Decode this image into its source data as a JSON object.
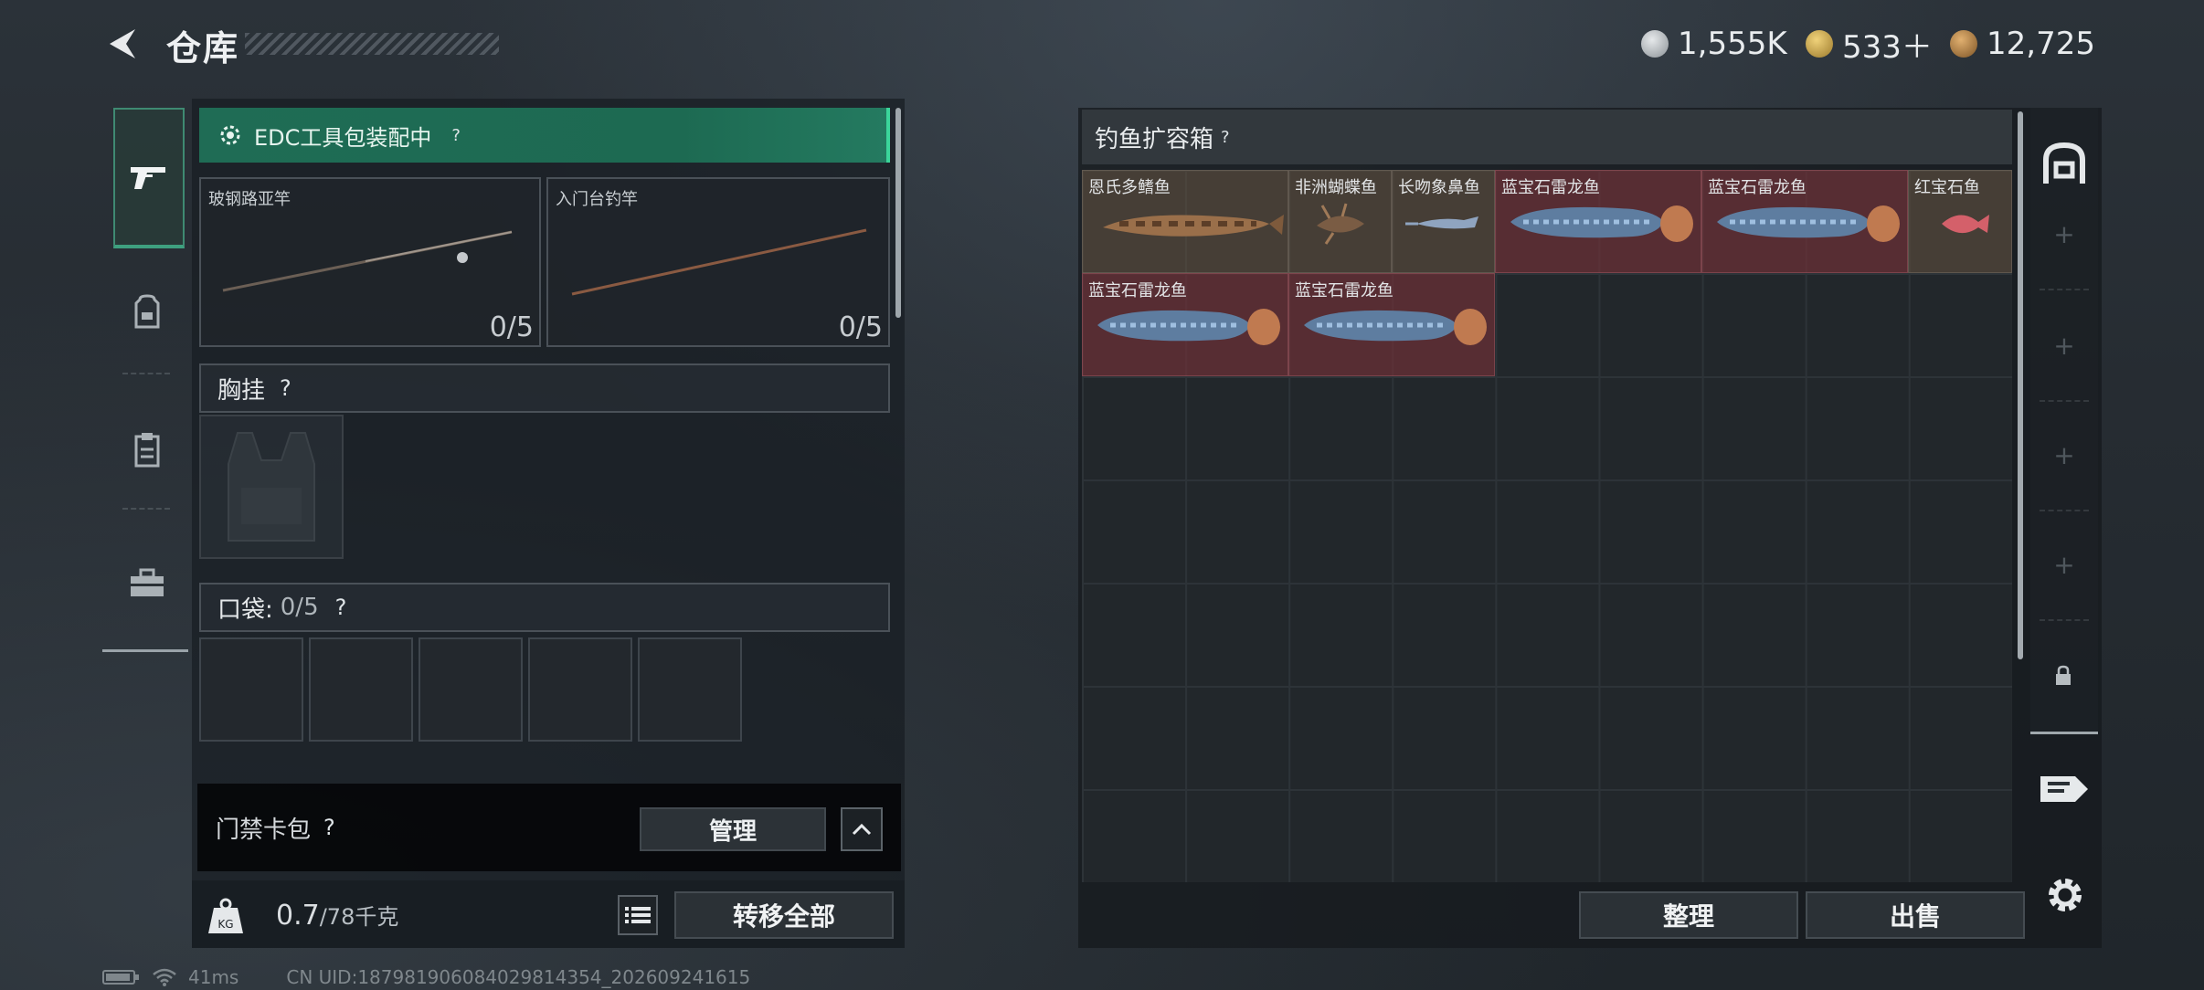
{
  "header": {
    "title": "仓库",
    "currencies": [
      {
        "icon": "silver-coin-icon",
        "value": "1,555K",
        "color": "#b9bec2"
      },
      {
        "icon": "gold-triangle-coin-icon",
        "value": "533＋",
        "color": "#c9a64a"
      },
      {
        "icon": "bronze-coin-icon",
        "value": "12,725",
        "color": "#b8874a"
      }
    ]
  },
  "left_tabs": [
    {
      "name": "pistol-icon",
      "active": true
    },
    {
      "name": "backpack-icon",
      "active": false
    },
    {
      "name": "clipboard-icon",
      "active": false
    },
    {
      "name": "toolbox-icon",
      "active": false
    }
  ],
  "equipment": {
    "edc_banner": "EDC工具包装配中",
    "help": "?",
    "rods": [
      {
        "name": "玻钢路亚竿",
        "count": "0/5"
      },
      {
        "name": "入门台钓竿",
        "count": "0/5"
      }
    ],
    "chest_rig_label": "胸挂",
    "pocket_label": "口袋:",
    "pocket_count": "0/5",
    "access_card_label": "门禁卡包",
    "manage_button": "管理",
    "weight_value": "0.7",
    "weight_total": "/78千克",
    "transfer_all_button": "转移全部"
  },
  "storage": {
    "title": "钓鱼扩容箱",
    "help": "?",
    "fish": [
      {
        "name": "恩氏多鳍鱼"
      },
      {
        "name": "非洲蝴蝶鱼"
      },
      {
        "name": "长吻象鼻鱼"
      },
      {
        "name": "蓝宝石雷龙鱼"
      },
      {
        "name": "蓝宝石雷龙鱼"
      },
      {
        "name": "红宝石鱼"
      },
      {
        "name": "蓝宝石雷龙鱼"
      },
      {
        "name": "蓝宝石雷龙鱼"
      }
    ],
    "sort_button": "整理",
    "sell_button": "出售"
  },
  "status": {
    "ping": "41ms",
    "uid": "CN UID:187981906084029814354_202609241615"
  }
}
